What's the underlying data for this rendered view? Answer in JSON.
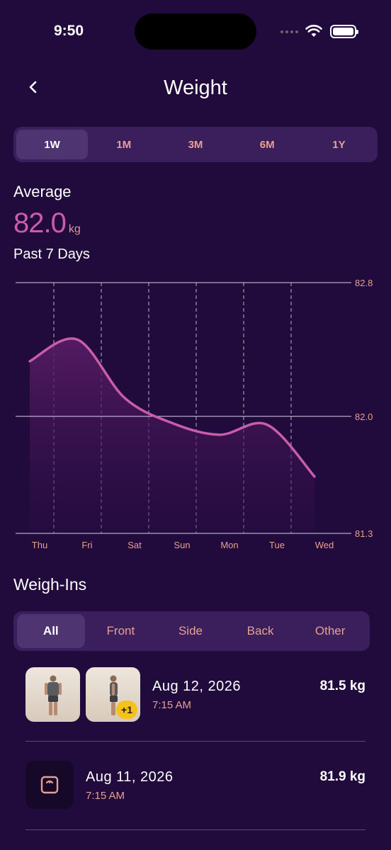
{
  "status_bar": {
    "time": "9:50"
  },
  "header": {
    "title": "Weight"
  },
  "range_tabs": [
    "1W",
    "1M",
    "3M",
    "6M",
    "1Y"
  ],
  "range_selected": "1W",
  "average": {
    "label": "Average",
    "value": "82.0",
    "unit": "kg",
    "period": "Past 7 Days"
  },
  "chart_data": {
    "type": "area",
    "x": [
      "Thu",
      "Fri",
      "Sat",
      "Sun",
      "Mon",
      "Tue",
      "Wed"
    ],
    "values": [
      82.33,
      82.46,
      82.11,
      81.96,
      81.89,
      81.95,
      81.64
    ],
    "y_ticks": [
      "82.8",
      "82.0",
      "81.3"
    ],
    "ylim": [
      81.3,
      82.8
    ],
    "grid": true,
    "colors": {
      "line": "#c95da9",
      "fill": "#4a1a5c",
      "grid": "#d9d0e4"
    }
  },
  "weighins": {
    "title": "Weigh-Ins",
    "tabs": [
      "All",
      "Front",
      "Side",
      "Back",
      "Other"
    ],
    "selected": "All",
    "entries": [
      {
        "date": "Aug 12, 2026",
        "time": "7:15 AM",
        "weight": "81.5 kg",
        "badge": "+1"
      },
      {
        "date": "Aug 11, 2026",
        "time": "7:15 AM",
        "weight": "81.9 kg"
      }
    ]
  }
}
